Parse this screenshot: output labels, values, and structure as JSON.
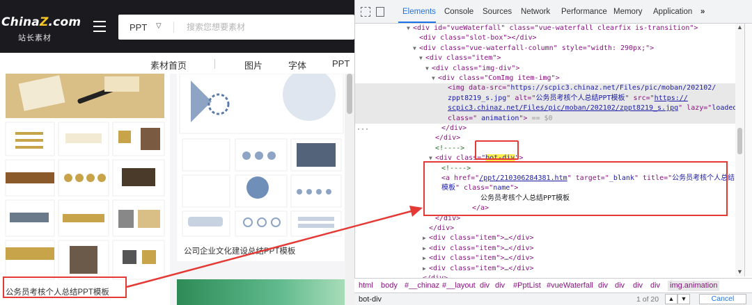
{
  "site": {
    "logo_main_a": "China",
    "logo_main_z": "Z",
    "logo_main_b": ".com",
    "logo_sub": "站长素材",
    "search_type": "PPT",
    "search_placeholder": "搜索您想要素材",
    "nav": [
      "素材首页",
      "图片",
      "字体",
      "PPT"
    ],
    "card1_caption": "公务员考核个人总结PPT模板",
    "card2_caption": "公司企业文化建设总结PPT模板"
  },
  "devtools": {
    "tabs": [
      "Elements",
      "Console",
      "Sources",
      "Network",
      "Performance",
      "Memory",
      "Application",
      "»"
    ],
    "lines": {
      "l0": "<div id=\"vueWaterfall\" class=\"vue-waterfall clearfix is-transition\">",
      "l1": "<div class=\"slot-box\"></div>",
      "l2": "<div class=\"vue-waterfall-column\" style=\"width: 290px;\">",
      "l3": "<div class=\"item\">",
      "l4": "<div class=\"img-div\">",
      "l5": "<div class=\"ComImg item-img\">",
      "l6a": "<img data-src=\"",
      "l6b": "https://scpic3.chinaz.net/Files/pic/moban/202102/",
      "l7a": "zppt8219_s.jpg",
      "l7b": "\" alt=\"",
      "l7c": "公务员考核个人总结PPT模板",
      "l7d": "\" src=\"",
      "l7e": "https://",
      "l8a": "scpic3.chinaz.net/Files/pic/moban/202102/zppt8219_s.jpg",
      "l8b": "\" lazy=\"",
      "l8c": "loaded",
      "l8d": "\"",
      "l9a": "class=\"",
      "l9b": " animation",
      "l9c": "\">",
      "l9d": " == $0",
      "l10": "</div>",
      "l11": "</div>",
      "l12": "<!---->",
      "l13a": "<div class=\"",
      "l13b": "bot-div",
      "l13c": "\">",
      "l14": "<!---->",
      "l15a": "<a href=\"",
      "l15b": "/ppt/210306284381.htm",
      "l15c": "\" target=\"",
      "l15d": "_blank",
      "l15e": "\" title=\"",
      "l15f": "公务员考核个人总结PPT",
      "l16a": "模板",
      "l16b": "\" class=\"",
      "l16c": "name",
      "l16d": "\">",
      "l17": "公务员考核个人总结PPT模板",
      "l18": "</a>",
      "l19": "</div>",
      "l20": "</div>",
      "l21": "<div class=\"item\">…</div>",
      "l22": "<div class=\"item\">…</div>",
      "l23": "<div class=\"item\">…</div>",
      "l24": "<div class=\"item\">…</div>",
      "l25": "</div>"
    },
    "breadcrumb": [
      "html",
      "body",
      "#__chinaz",
      "#__layout",
      "div",
      "div",
      "#PptList",
      "#vueWaterfall",
      "div",
      "div",
      "div",
      "div",
      "img.animation"
    ],
    "search_value": "bot-div",
    "search_count": "1 of 20",
    "cancel_label": "Cancel"
  }
}
